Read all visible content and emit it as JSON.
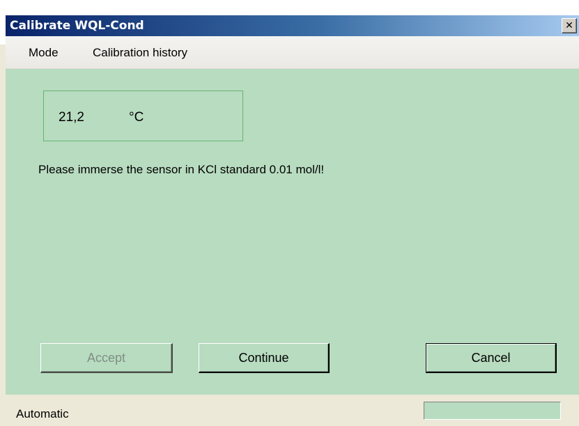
{
  "window": {
    "title": "Calibrate WQL-Cond",
    "close_glyph": "✕"
  },
  "menu": {
    "items": [
      {
        "label": "Mode"
      },
      {
        "label": "Calibration history"
      }
    ]
  },
  "temperature": {
    "value": "21,2",
    "unit": "°C"
  },
  "instruction": "Please immerse the sensor in KCl standard 0.01 mol/l!",
  "buttons": {
    "accept": "Accept",
    "continue": "Continue",
    "cancel": "Cancel"
  },
  "status": {
    "text": "Automatic"
  },
  "colors": {
    "client_background": "#b8dcc0",
    "title_gradient_start": "#0a246a",
    "title_gradient_end": "#a6caf0"
  }
}
